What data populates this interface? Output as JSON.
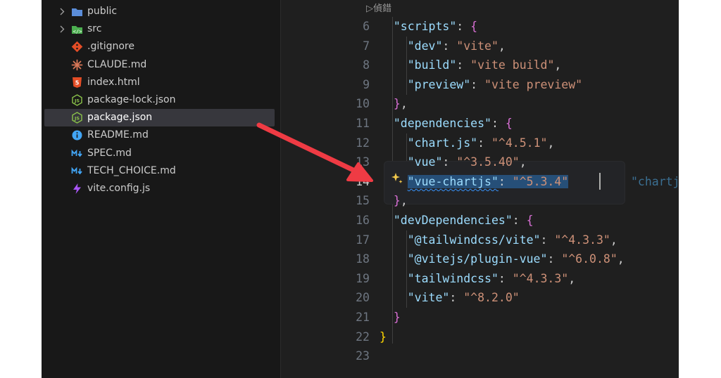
{
  "explorer": {
    "items": [
      {
        "label": "public",
        "icon": "folder-icon",
        "kind": "folder",
        "color": "#5b8dd9"
      },
      {
        "label": "src",
        "icon": "folder-src-icon",
        "kind": "folder",
        "color": "#4caf50"
      },
      {
        "label": ".gitignore",
        "icon": "git-icon",
        "kind": "file",
        "color": "#e44d26"
      },
      {
        "label": "CLAUDE.md",
        "icon": "claude-icon",
        "kind": "file",
        "color": "#d97757"
      },
      {
        "label": "index.html",
        "icon": "html-icon",
        "kind": "file",
        "color": "#e44d26"
      },
      {
        "label": "package-lock.json",
        "icon": "nodejs-icon",
        "kind": "file",
        "color": "#8bc34a"
      },
      {
        "label": "package.json",
        "icon": "nodejs-icon",
        "kind": "file",
        "color": "#8bc34a",
        "selected": true
      },
      {
        "label": "README.md",
        "icon": "info-icon",
        "kind": "file",
        "color": "#42a5f5"
      },
      {
        "label": "SPEC.md",
        "icon": "markdown-icon",
        "kind": "file",
        "color": "#42a5f5"
      },
      {
        "label": "TECH_CHOICE.md",
        "icon": "markdown-icon",
        "kind": "file",
        "color": "#42a5f5"
      },
      {
        "label": "vite.config.js",
        "icon": "vite-icon",
        "kind": "file",
        "color": "#a855f7"
      }
    ]
  },
  "editor": {
    "codelens": "▷偵錯",
    "active_line": 14,
    "line_numbers": [
      "6",
      "7",
      "8",
      "9",
      "10",
      "11",
      "12",
      "13",
      "14",
      "15",
      "16",
      "17",
      "18",
      "19",
      "20",
      "21",
      "22",
      "23"
    ],
    "code": {
      "scripts_key": "\"scripts\"",
      "dev_key": "\"dev\"",
      "dev_val": "\"vite\"",
      "build_key": "\"build\"",
      "build_val": "\"vite build\"",
      "preview_key": "\"preview\"",
      "preview_val": "\"vite preview\"",
      "deps_key": "\"dependencies\"",
      "chartjs_key": "\"chart.js\"",
      "chartjs_val": "\"^4.5.1\"",
      "vue_key": "\"vue\"",
      "vue_val": "\"^3.5.40\"",
      "vuechartjs_key": "\"vue-chartjs\"",
      "vuechartjs_val": "\"^5.3.4\"",
      "devdeps_key": "\"devDependencies\"",
      "tw_vite_key": "\"@tailwindcss/vite\"",
      "tw_vite_val": "\"^4.3.3\"",
      "plugin_vue_key": "\"@vitejs/plugin-vue\"",
      "plugin_vue_val": "\"^6.0.8\"",
      "tw_key": "\"tailwindcss\"",
      "tw_val": "\"^4.3.3\"",
      "vite_key": "\"vite\"",
      "vite_val": "\"^8.2.0\""
    },
    "ghost_suggestion": "\"chartjs\": \""
  },
  "colors": {
    "annotation_arrow": "#ef3b44",
    "selection": "#264f78",
    "key": "#9cdcfe",
    "string": "#ce9178"
  }
}
